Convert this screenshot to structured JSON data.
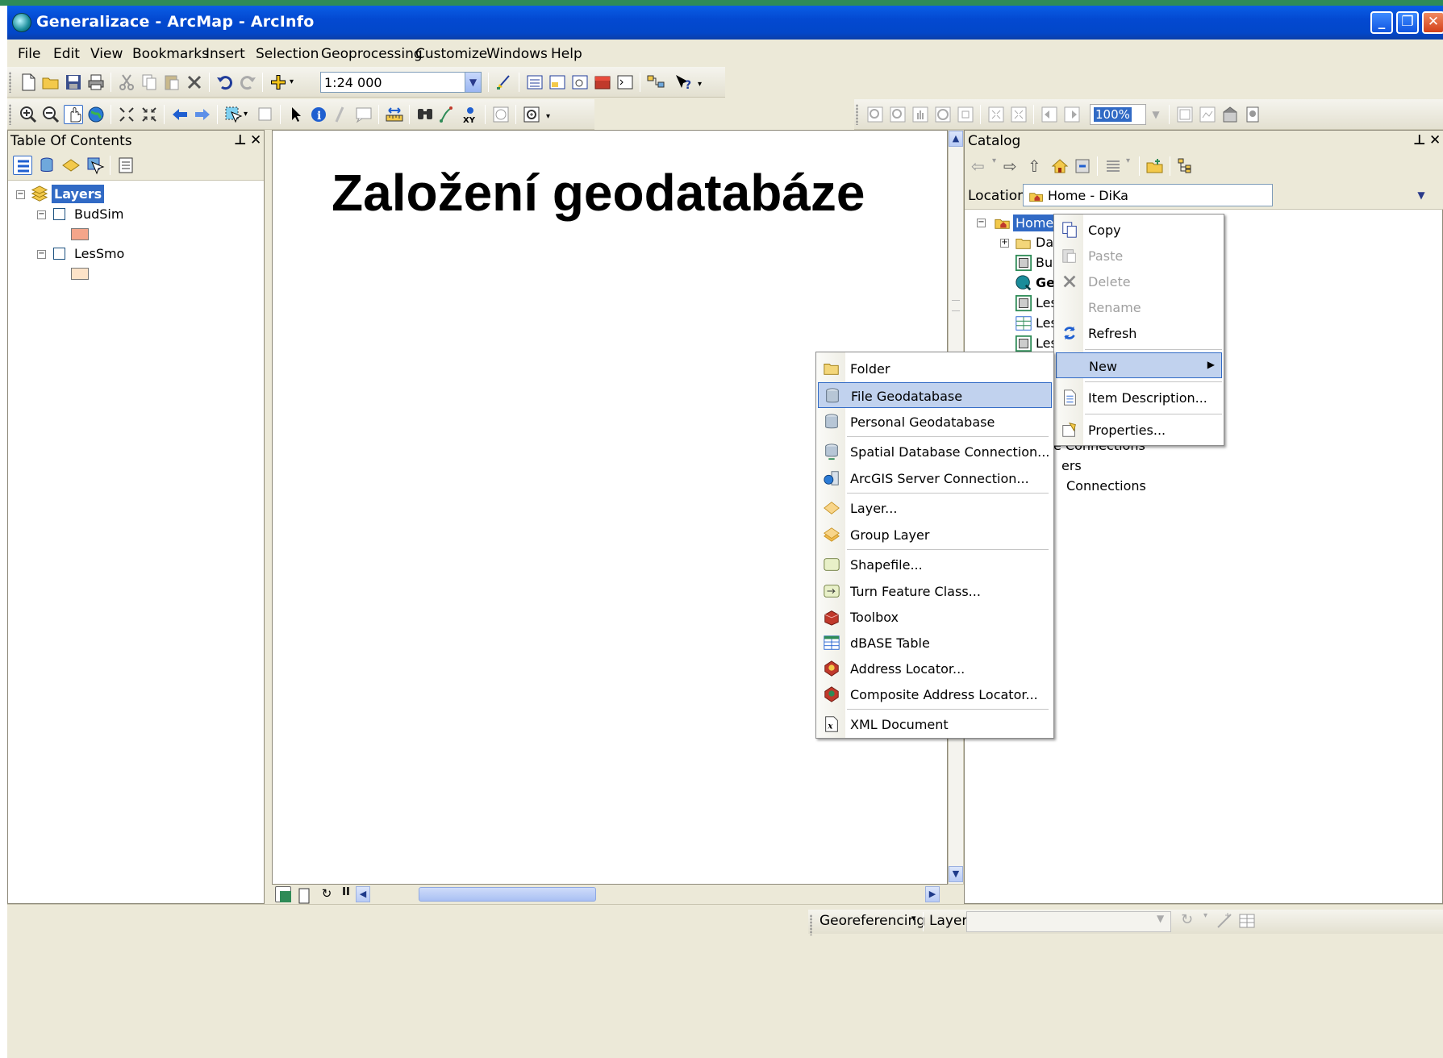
{
  "window": {
    "title": "Generalizace - ArcMap - ArcInfo"
  },
  "menu": [
    "File",
    "Edit",
    "View",
    "Bookmarks",
    "Insert",
    "Selection",
    "Geoprocessing",
    "Customize",
    "Windows",
    "Help"
  ],
  "toolbar": {
    "scale": "1:24 000",
    "layout_zoom": "100%"
  },
  "toc": {
    "title": "Table Of Contents",
    "root": "Layers",
    "layers": [
      {
        "name": "BudSim",
        "color": "#f4a58a"
      },
      {
        "name": "LesSmo",
        "color": "#fde3c8"
      }
    ]
  },
  "slide_title": "Založení geodatabáze",
  "catalog": {
    "title": "Catalog",
    "location_label": "Location:",
    "location_value": "Home - DiKa",
    "tree": [
      "Home -",
      "Dat",
      "Bud",
      "Ger",
      "Les",
      "Les",
      "Les"
    ],
    "behind": [
      "e Connections",
      "ers",
      "Connections"
    ]
  },
  "context_menu": {
    "items": [
      {
        "label": "Copy",
        "enabled": true
      },
      {
        "label": "Paste",
        "enabled": false
      },
      {
        "label": "Delete",
        "enabled": false
      },
      {
        "label": "Rename",
        "enabled": false
      },
      {
        "label": "Refresh",
        "enabled": true
      },
      {
        "label": "New",
        "enabled": true
      },
      {
        "label": "Item Description...",
        "enabled": true
      },
      {
        "label": "Properties...",
        "enabled": true
      }
    ]
  },
  "new_submenu": {
    "items": [
      "Folder",
      "File Geodatabase",
      "Personal Geodatabase",
      "Spatial Database Connection...",
      "ArcGIS Server Connection...",
      "Layer...",
      "Group Layer",
      "Shapefile...",
      "Turn Feature Class...",
      "Toolbox",
      "dBASE Table",
      "Address Locator...",
      "Composite Address Locator...",
      "XML Document"
    ],
    "highlighted": "File Geodatabase"
  },
  "statusbar": {
    "georef": "Georeferencing",
    "layer_label": "Layer:"
  },
  "colors": {
    "title_blue": "#0349d1",
    "highlight": "#316ac5",
    "menu_bg": "#ece9d8"
  }
}
